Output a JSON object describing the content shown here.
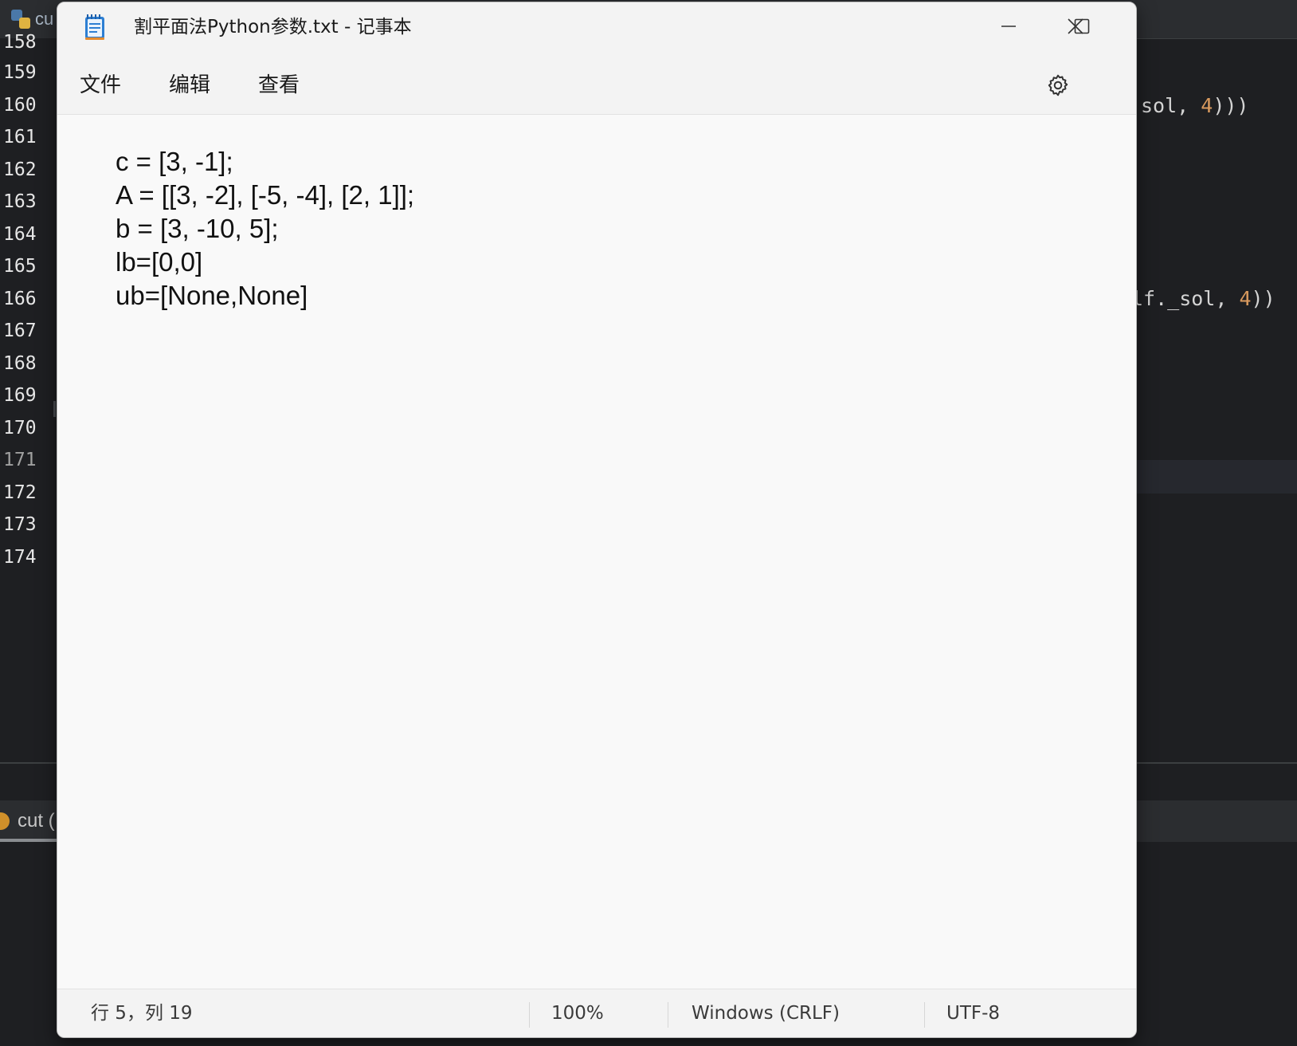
{
  "ide": {
    "tab_label": "cu",
    "line_numbers": [
      "158",
      "159",
      "160",
      "161",
      "162",
      "163",
      "164",
      "165",
      "166",
      "167",
      "168",
      "169",
      "170",
      "171",
      "172",
      "173",
      "174"
    ],
    "current_line": "171",
    "code_fragment_160": {
      "text": "sol, ",
      "num": "4",
      "tail": ")))"
    },
    "code_fragment_166": {
      "text": "lf._sol, ",
      "num": "4",
      "tail": "))"
    },
    "run_tab_label": "cut ("
  },
  "notepad": {
    "title": "割平面法Python参数.txt - 记事本",
    "menu": {
      "file": "文件",
      "edit": "编辑",
      "view": "查看"
    },
    "content_lines": [
      "c = [3, -1];",
      "A = [[3, -2], [-5, -4], [2, 1]];",
      "b = [3, -10, 5];",
      "lb=[0,0]",
      "ub=[None,None]"
    ],
    "status": {
      "position": "行 5，列 19",
      "zoom": "100%",
      "line_ending": "Windows (CRLF)",
      "encoding": "UTF-8"
    }
  },
  "icons": {
    "app": "notepad-icon",
    "minimize": "minimize-icon",
    "maximize": "maximize-icon",
    "close": "close-icon",
    "settings": "gear-icon"
  },
  "colors": {
    "ide_background": "#1e1f22",
    "code_number": "#d99a5e",
    "notepad_background": "#f9f9f9"
  }
}
